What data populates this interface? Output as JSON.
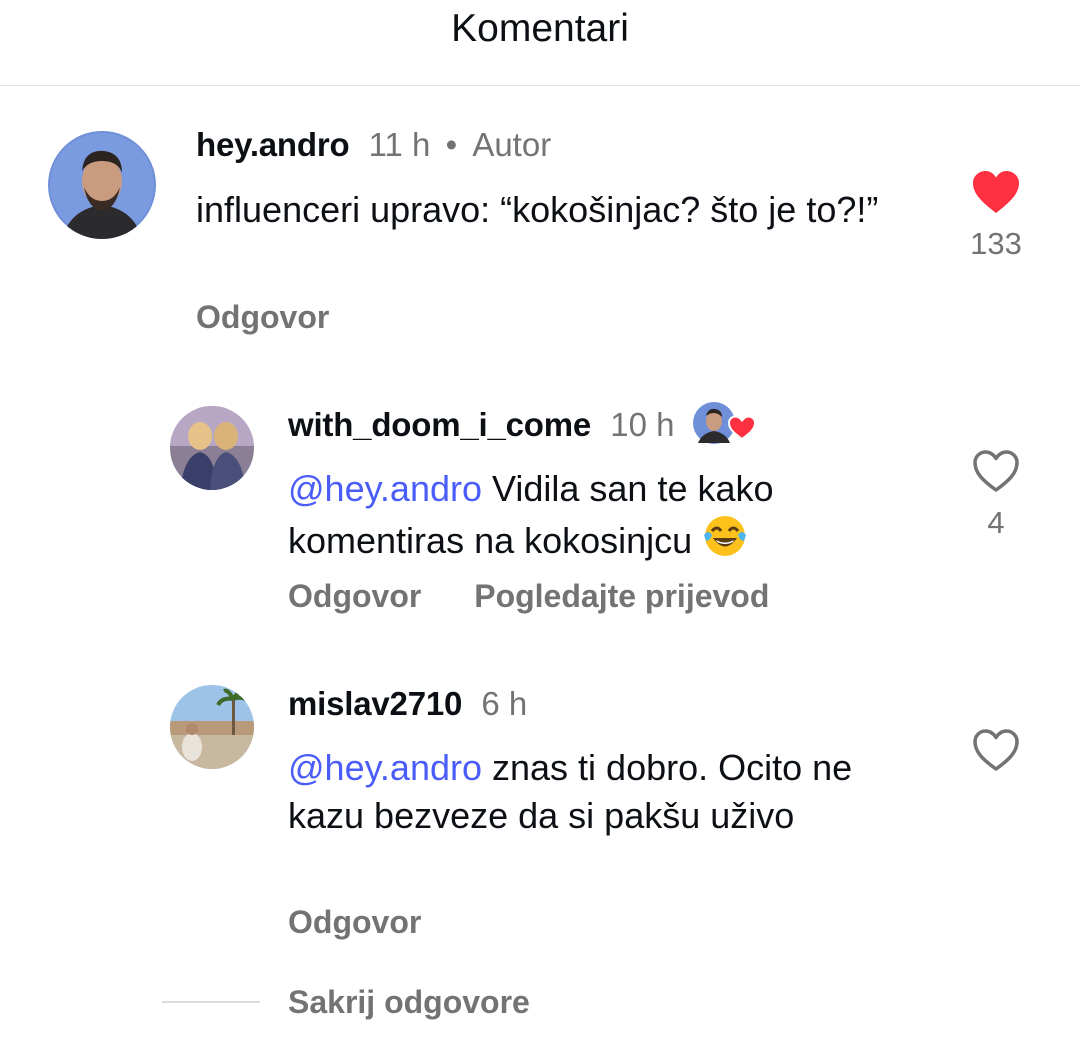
{
  "header": {
    "title": "Komentari"
  },
  "comments": [
    {
      "username": "hey.andro",
      "time": "11 h",
      "separator": "•",
      "badge": "Autor",
      "text": "influenceri upravo: “kokošinjac? što je to?!”",
      "reply_label": "Odgovor",
      "likes": "133",
      "liked": true,
      "avatar_icon": "avatar-photo-man-beard"
    }
  ],
  "replies": [
    {
      "username": "with_doom_i_come",
      "time": "10 h",
      "mention": "@hey.andro",
      "text": " Vidila san te kako komentiras na kokosinjcu ",
      "emoji": "😂",
      "reply_label": "Odgovor",
      "translate_label": "Pogledajte prijevod",
      "likes": "4",
      "liked": false,
      "author_liked_icon": "author-avatar-heart-badge"
    },
    {
      "username": "mislav2710",
      "time": "6 h",
      "mention": "@hey.andro",
      "text": " znas ti dobro. Ocito ne kazu bezveze da si pakšu uživo",
      "reply_label": "Odgovor",
      "likes": "",
      "liked": false
    }
  ],
  "hide_replies_label": "Sakrij odgovore",
  "colors": {
    "heart_filled": "#ff3040",
    "mention": "#4a5df9",
    "secondary_text": "#737373",
    "divider": "#e3e3e3"
  }
}
